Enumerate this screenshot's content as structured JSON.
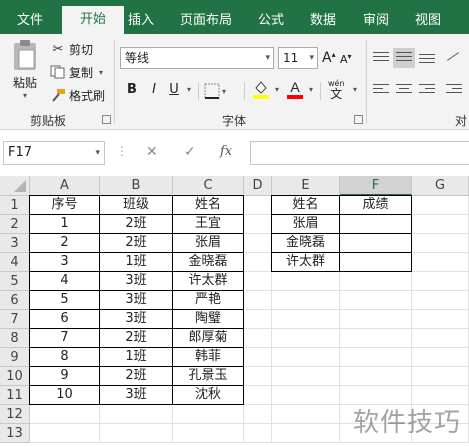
{
  "ribbon": {
    "tabs": [
      "文件",
      "开始",
      "插入",
      "页面布局",
      "公式",
      "数据",
      "审阅",
      "视图"
    ],
    "active_tab": "开始",
    "clipboard": {
      "paste": "粘贴",
      "cut": "剪切",
      "copy": "复制",
      "format_painter": "格式刷",
      "group_label": "剪贴板"
    },
    "font": {
      "name": "等线",
      "size": "11",
      "bold": "B",
      "italic": "I",
      "underline": "U",
      "group_label": "字体",
      "phonetic": "wén",
      "grow": "A",
      "shrink": "A"
    },
    "partial_group_label": "对齐"
  },
  "formula_bar": {
    "name_box": "F17",
    "fx": "fx"
  },
  "sheet": {
    "columns": [
      "A",
      "B",
      "C",
      "D",
      "E",
      "F",
      "G"
    ],
    "selected_column": "F",
    "rows": [
      "1",
      "2",
      "3",
      "4",
      "5",
      "6",
      "7",
      "8",
      "9",
      "10",
      "11",
      "12",
      "13"
    ],
    "table1_header": [
      "序号",
      "班级",
      "姓名"
    ],
    "table1_rows": [
      [
        "1",
        "2班",
        "王宜"
      ],
      [
        "2",
        "2班",
        "张眉"
      ],
      [
        "3",
        "1班",
        "金晓磊"
      ],
      [
        "4",
        "3班",
        "许太群"
      ],
      [
        "5",
        "3班",
        "严艳"
      ],
      [
        "6",
        "3班",
        "陶璧"
      ],
      [
        "7",
        "2班",
        "郎厚菊"
      ],
      [
        "8",
        "1班",
        "韩菲"
      ],
      [
        "9",
        "2班",
        "孔景玉"
      ],
      [
        "10",
        "3班",
        "沈秋"
      ]
    ],
    "table2_header": [
      "姓名",
      "成绩"
    ],
    "table2_rows": [
      [
        "张眉",
        ""
      ],
      [
        "金晓磊",
        ""
      ],
      [
        "许太群",
        ""
      ]
    ]
  },
  "watermark": "软件技巧",
  "colors": {
    "excel_green": "#217346",
    "ribbon_bg": "#f3f3f3",
    "header_bg": "#e9e9e9",
    "highlight_yellow": "#ffff00",
    "font_red": "#ff0000"
  }
}
